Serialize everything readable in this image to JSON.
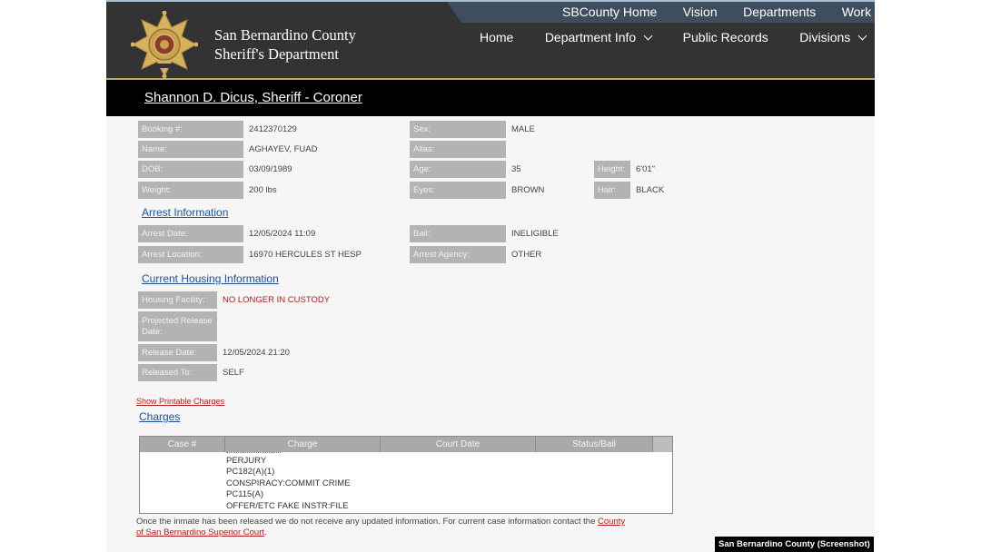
{
  "header": {
    "dept_line1": "San Bernardino County",
    "dept_line2": "Sheriff's Department",
    "top_links": [
      "SBCounty Home",
      "Vision",
      "Departments",
      "Work wit"
    ],
    "nav": [
      {
        "label": "Home",
        "dropdown": false
      },
      {
        "label": "Department Info",
        "dropdown": true
      },
      {
        "label": "Public Records",
        "dropdown": false
      },
      {
        "label": "Divisions",
        "dropdown": true
      }
    ]
  },
  "sheriff_bar": {
    "text": "Shannon D. Dicus, Sheriff - Coroner"
  },
  "inmate": {
    "booking_label": "Booking #:",
    "booking": "2412370129",
    "name_label": "Name:",
    "name": "AGHAYEV, FUAD",
    "dob_label": "DOB:",
    "dob": "03/09/1989",
    "weight_label": "Weight:",
    "weight": "200 lbs",
    "sex_label": "Sex:",
    "sex": "MALE",
    "alias_label": "Alias:",
    "alias": "",
    "age_label": "Age:",
    "age": "35",
    "eyes_label": "Eyes:",
    "eyes": "BROWN",
    "height_label": "Height:",
    "height": "6'01\"",
    "hair_label": "Hair:",
    "hair": "BLACK"
  },
  "arrest": {
    "heading": "Arrest Information",
    "date_label": "Arrest Date:",
    "date": "12/05/2024 11:09",
    "location_label": "Arrest Location:",
    "location": "16970 HERCULES ST HESP",
    "bail_label": "Bail:",
    "bail": "INELIGIBLE",
    "agency_label": "Arrest Agency:",
    "agency": "OTHER"
  },
  "housing": {
    "heading": "Current Housing Information",
    "facility_label": "Housing Facility:",
    "facility": "NO LONGER IN CUSTODY",
    "projected_label_1": "Projected Release",
    "projected_label_2": "Date:",
    "projected": "",
    "release_label": "Release Date:",
    "release": "12/05/2024 21:20",
    "released_to_label": "Released To:",
    "released_to": "SELF"
  },
  "charges": {
    "printable_link": "Show Printable Charges",
    "heading": "Charges",
    "columns": [
      "Case #",
      "Charge",
      "Court Date",
      "Status/Bail"
    ],
    "lines": [
      "PERJURY",
      "PC182(A)(1)",
      "CONSPIRACY:COMMIT CRIME",
      "PC115(A)",
      "OFFER/ETC FAKE INSTR:FILE"
    ]
  },
  "footnote": {
    "text": "Once the inmate has been released we do not receive any updated information. For current case information contact the ",
    "link_1": "County",
    "link_2": "of San Bernardino Superior Court",
    "end": "."
  },
  "credit": "San Bernardino County (Screenshot)",
  "colors": {
    "header_bg": "#333333",
    "label_bg": "#b3b3b3",
    "link_blue": "#1d4f9a",
    "alert_red": "#b01c1c"
  }
}
